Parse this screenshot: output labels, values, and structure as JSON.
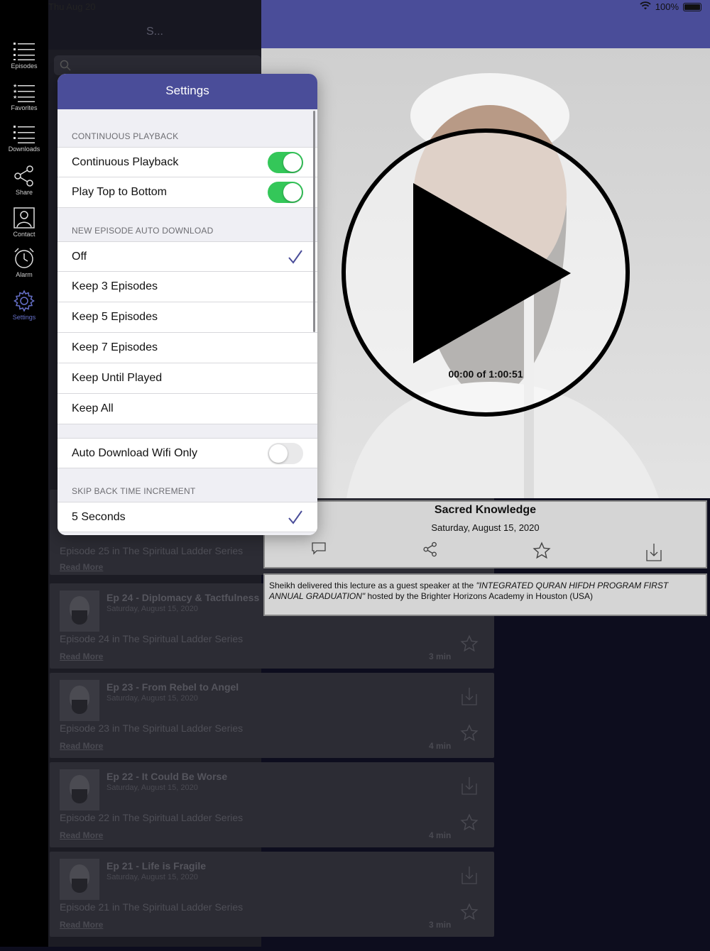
{
  "status": {
    "time": "Thu Aug 20",
    "battery": "100%"
  },
  "sidebar": {
    "items": [
      {
        "label": "Episodes",
        "icon": "list-icon"
      },
      {
        "label": "Favorites",
        "icon": "star-list-icon"
      },
      {
        "label": "Downloads",
        "icon": "download-list-icon"
      },
      {
        "label": "Share",
        "icon": "share-icon"
      },
      {
        "label": "Contact",
        "icon": "contact-icon"
      },
      {
        "label": "Alarm",
        "icon": "alarm-icon"
      },
      {
        "label": "Settings",
        "icon": "gear-icon"
      }
    ],
    "active": "Settings"
  },
  "list": {
    "title": "S...",
    "episodes": [
      {
        "title": "",
        "date": "",
        "desc": "Episode 25 in The Spiritual Ladder Series",
        "more": "Read More",
        "duration": ""
      },
      {
        "title": "Ep 24 - Diplomacy & Tactfulness",
        "date": "Saturday, August 15, 2020",
        "desc": "Episode 24 in The Spiritual Ladder Series",
        "more": "Read More",
        "duration": "3 min"
      },
      {
        "title": "Ep 23 - From Rebel to Angel",
        "date": "Saturday, August 15, 2020",
        "desc": "Episode 23 in The Spiritual Ladder Series",
        "more": "Read More",
        "duration": "4 min"
      },
      {
        "title": "Ep 22 - It Could Be Worse",
        "date": "Saturday, August 15, 2020",
        "desc": "Episode 22 in The Spiritual Ladder Series",
        "more": "Read More",
        "duration": "4 min"
      },
      {
        "title": "Ep 21 - Life is Fragile",
        "date": "Saturday, August 15, 2020",
        "desc": "Episode 21 in The Spiritual Ladder Series",
        "more": "Read More",
        "duration": "3 min"
      }
    ]
  },
  "player": {
    "time": "00:00 of 1:00:51",
    "title": "Sacred Knowledge",
    "date": "Saturday, August 15, 2020",
    "description": "Sheikh delivered this lecture as a guest speaker at the ",
    "description_italic": "\"INTEGRATED QURAN HIFDH PROGRAM FIRST ANNUAL GRADUATION\"",
    "description_end": " hosted by the Brighter Horizons Academy in Houston (USA)"
  },
  "settings": {
    "title": "Settings",
    "sections": {
      "continuous": "CONTINUOUS PLAYBACK",
      "auto_download": "NEW EPISODE AUTO DOWNLOAD",
      "skip_back": "SKIP BACK TIME INCREMENT"
    },
    "rows": {
      "continuous_playback": {
        "label": "Continuous Playback",
        "on": true
      },
      "play_top_to_bottom": {
        "label": "Play Top to Bottom",
        "on": true
      },
      "off": {
        "label": "Off",
        "checked": true
      },
      "keep3": {
        "label": "Keep 3 Episodes"
      },
      "keep5": {
        "label": "Keep 5 Episodes"
      },
      "keep7": {
        "label": "Keep 7 Episodes"
      },
      "keep_until": {
        "label": "Keep Until Played"
      },
      "keep_all": {
        "label": "Keep All"
      },
      "wifi_only": {
        "label": "Auto Download Wifi Only",
        "on": false
      },
      "five_seconds": {
        "label": "5 Seconds",
        "checked": true
      }
    }
  },
  "colors": {
    "accent": "#4a4d99",
    "toggle_on": "#34c759",
    "check": "#4a4d99"
  }
}
